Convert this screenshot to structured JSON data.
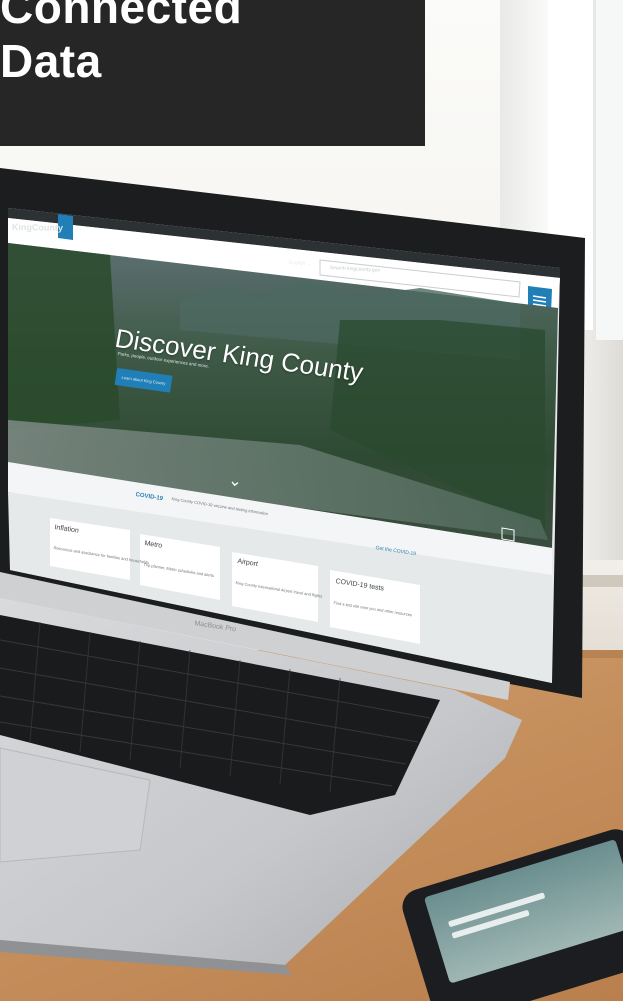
{
  "heading": {
    "line1": "Connected",
    "line2": "Data"
  },
  "screen": {
    "site_logo": "KingCounty",
    "language_select": "English ⌄",
    "search_placeholder": "Search kingcounty.gov",
    "hero_title": "Discover King County",
    "hero_subtitle": "Parks, people, outdoor experiences and more.",
    "hero_button": "Learn about King County",
    "covid_label": "COVID-19",
    "covid_text": "King County COVID-19 vaccine and testing information",
    "covid_link": "Get the COVID-19",
    "cards": [
      {
        "title": "Inflation",
        "desc": "Resources and assistance for families and households"
      },
      {
        "title": "Metro",
        "desc": "Trip planner, Metro schedules and alerts"
      },
      {
        "title": "Airport",
        "desc": "King County International Airport travel and flights"
      },
      {
        "title": "COVID-19 tests",
        "desc": "Find a test site near you and other resources"
      }
    ]
  },
  "laptop_label": "MacBook Pro",
  "colors": {
    "heading_bg": "#262626",
    "accent_blue": "#1f7fb6"
  }
}
